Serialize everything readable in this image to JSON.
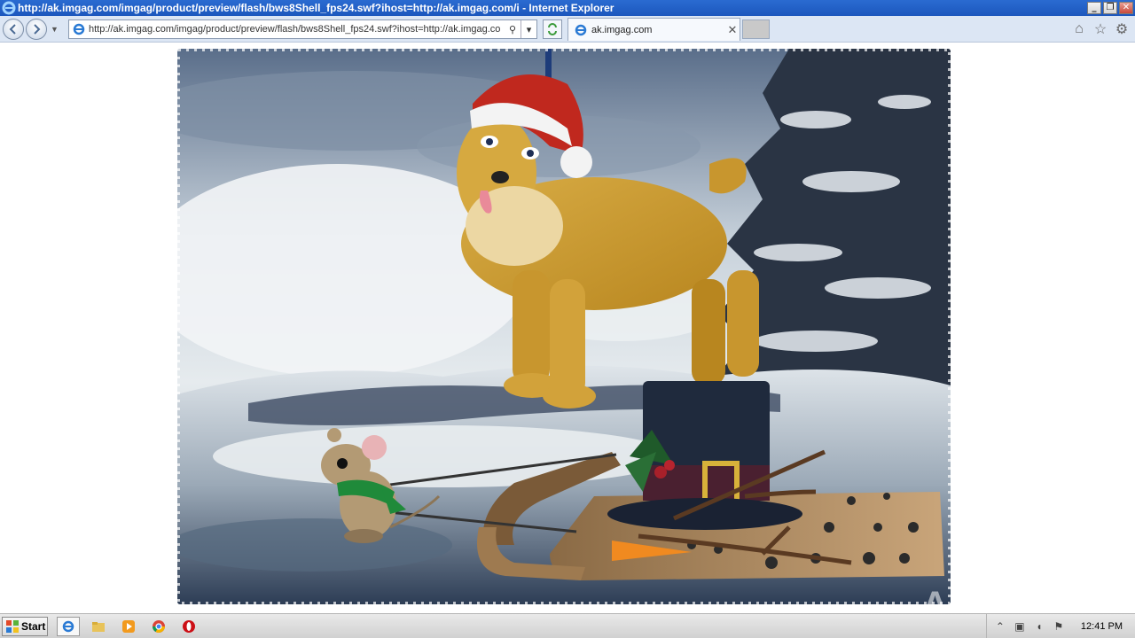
{
  "window": {
    "title": "http://ak.imgag.com/imgag/product/preview/flash/bws8Shell_fps24.swf?ihost=http://ak.imgag.com/i - Internet Explorer",
    "minimize_glyph": "_",
    "maximize_glyph": "❐",
    "close_glyph": "✕"
  },
  "toolbar": {
    "address_url": "http://ak.imgag.com/imgag/product/preview/flash/bws8Shell_fps24.swf?ihost=http://ak.imgag.co",
    "search_glyph": "⚲",
    "dropdown_glyph": "▾",
    "tab_title": "ak.imgag.com",
    "tab_close": "✕"
  },
  "right_icons": [
    "home-icon",
    "star-icon",
    "gear-icon"
  ],
  "content": {
    "image_description_icon": "flash-movie"
  },
  "watermark": {
    "text": "ANY RUN"
  },
  "taskbar": {
    "start_label": "Start",
    "clock": "12:41 PM",
    "apps": [
      "internet-explorer-icon",
      "folder-icon",
      "media-player-icon",
      "chrome-icon",
      "opera-icon"
    ]
  },
  "colors": {
    "titlebar": "#1c57bd",
    "toolbar": "#dce6f4",
    "taskbar": "#d1d1d1"
  }
}
